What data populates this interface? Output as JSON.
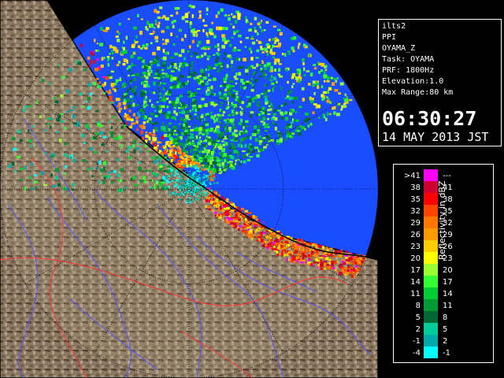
{
  "info": {
    "lines": [
      "ilts2",
      "PPI",
      "OYAMA_Z",
      "Task: OYAMA",
      "PRF: 1800Hz",
      "Elevation:1.0",
      "Max Range:80 km"
    ],
    "time": "06:30:27",
    "date": "14 MAY 2013 JST"
  },
  "legend": {
    "unit_label": "Reflectivity in dBZ",
    "bins": [
      {
        "low": ">41",
        "high": "---",
        "color": "#ff00ff"
      },
      {
        "low": "38",
        "high": "41",
        "color": "#cc0033"
      },
      {
        "low": "35",
        "high": "38",
        "color": "#ff0000"
      },
      {
        "low": "32",
        "high": "35",
        "color": "#ff4400"
      },
      {
        "low": "29",
        "high": "32",
        "color": "#ff7700"
      },
      {
        "low": "26",
        "high": "29",
        "color": "#ff9900"
      },
      {
        "low": "23",
        "high": "26",
        "color": "#ffcc00"
      },
      {
        "low": "20",
        "high": "23",
        "color": "#ffff00"
      },
      {
        "low": "17",
        "high": "20",
        "color": "#99ff33"
      },
      {
        "low": "14",
        "high": "17",
        "color": "#33ff33"
      },
      {
        "low": "11",
        "high": "14",
        "color": "#00cc33"
      },
      {
        "low": "8",
        "high": "11",
        "color": "#009933"
      },
      {
        "low": "5",
        "high": "8",
        "color": "#006633"
      },
      {
        "low": "2",
        "high": "5",
        "color": "#00cc99"
      },
      {
        "low": "-1",
        "high": "2",
        "color": "#00aaaa"
      },
      {
        "low": "-4",
        "high": "-1",
        "color": "#00ffff"
      }
    ]
  },
  "colors": {
    "coverage": "#1a4dff",
    "terrain": "#8a7660",
    "sea": "#1a4dff",
    "rivers": "#5555ff",
    "borders": "#ff3333"
  }
}
